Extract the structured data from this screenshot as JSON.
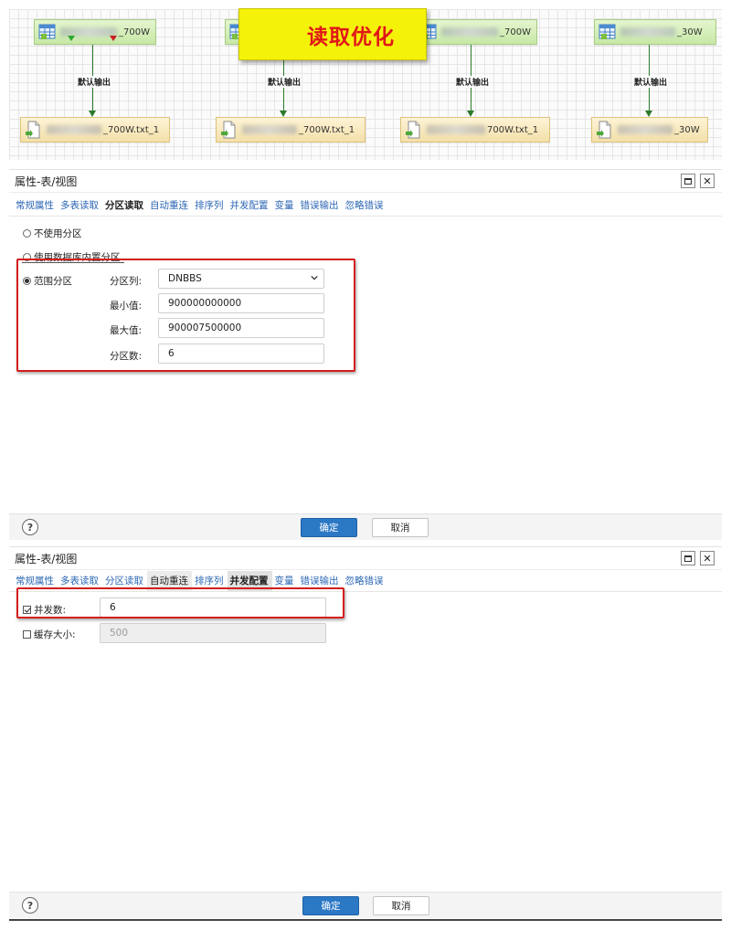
{
  "flow": {
    "banner": "读取优化",
    "sources": [
      {
        "suffix": "_700W"
      },
      {
        "suffix": ""
      },
      {
        "suffix": "_700W"
      },
      {
        "suffix": "_30W"
      }
    ],
    "edge_label": "默认输出",
    "targets": [
      {
        "suffix": "_700W.txt_1"
      },
      {
        "suffix": "_700W.txt_1"
      },
      {
        "suffix": "700W.txt_1"
      },
      {
        "suffix": "_30W"
      }
    ]
  },
  "dialog1": {
    "title": "属性-表/视图",
    "tabs": [
      "常规属性",
      "多表读取",
      "分区读取",
      "自动重连",
      "排序列",
      "并发配置",
      "变量",
      "错误输出",
      "忽略错误"
    ],
    "active_tab": "分区读取",
    "options": {
      "no_partition": "不使用分区",
      "db_partition": "使用数据库内置分区",
      "range_partition": "范围分区"
    },
    "selected_option": "范围分区",
    "fields": {
      "partition_column_label": "分区列:",
      "partition_column_value": "DNBBS",
      "min_label": "最小值:",
      "min_value": "900000000000",
      "max_label": "最大值:",
      "max_value": "900007500000",
      "count_label": "分区数:",
      "count_value": "6"
    },
    "footer": {
      "ok": "确定",
      "cancel": "取消",
      "help": "?"
    }
  },
  "dialog2": {
    "title": "属性-表/视图",
    "tabs": [
      "常规属性",
      "多表读取",
      "分区读取",
      "自动重连",
      "排序列",
      "并发配置",
      "变量",
      "错误输出",
      "忽略错误"
    ],
    "active_tab": "并发配置",
    "fields": {
      "concurrency_label": "并发数:",
      "concurrency_checked": true,
      "concurrency_value": "6",
      "cache_label": "缓存大小:",
      "cache_checked": false,
      "cache_value": "500"
    },
    "footer": {
      "ok": "确定",
      "cancel": "取消",
      "help": "?"
    }
  },
  "colors": {
    "accent_button": "#2b78c5",
    "tab_link": "#2c67b4",
    "highlight_box": "#d41e1e",
    "banner_bg": "#f5f20a",
    "banner_text": "#e01818",
    "edge": "#2a7a2a"
  }
}
